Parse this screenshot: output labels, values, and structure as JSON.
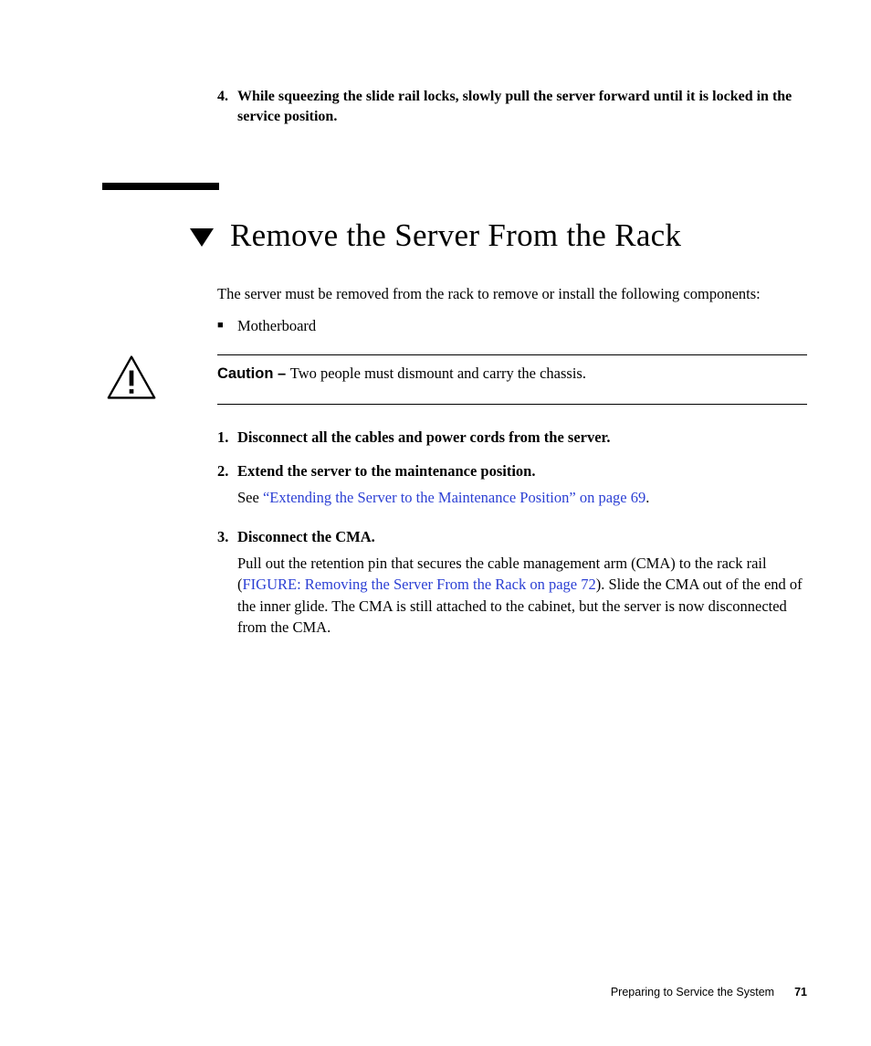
{
  "top_step": {
    "number": "4.",
    "text": "While squeezing the slide rail locks, slowly pull the server forward until it is locked in the service position."
  },
  "section": {
    "title": "Remove the Server From the Rack",
    "intro": "The server must be removed from the rack to remove or install the following components:",
    "bullets": [
      "Motherboard"
    ]
  },
  "caution": {
    "label": "Caution – ",
    "text": "Two people must dismount and carry the chassis."
  },
  "steps": [
    {
      "n": "1.",
      "title": "Disconnect all the cables and power cords from the server."
    },
    {
      "n": "2.",
      "title": "Extend the server to the maintenance position.",
      "para_before": "See ",
      "link": "“Extending the Server to the Maintenance Position” on page 69",
      "para_after": "."
    },
    {
      "n": "3.",
      "title": "Disconnect the CMA.",
      "para_before": "Pull out the retention pin that secures the cable management arm (CMA) to the rack rail (",
      "link": "FIGURE: Removing the Server From the Rack on page 72",
      "para_after": "). Slide the CMA out of the end of the inner glide. The CMA is still attached to the cabinet, but the server is now disconnected from the CMA."
    }
  ],
  "footer": {
    "chapter": "Preparing to Service the System",
    "page": "71"
  }
}
